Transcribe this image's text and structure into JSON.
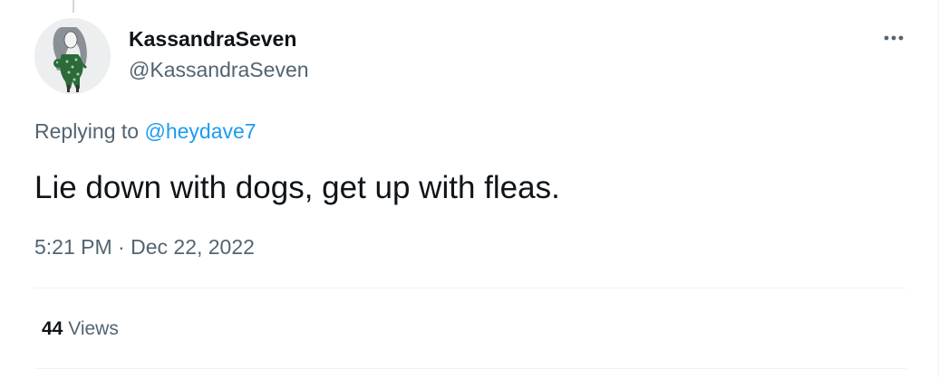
{
  "tweet": {
    "display_name": "KassandraSeven",
    "handle": "@KassandraSeven",
    "more_icon": "more-horizontal-icon",
    "replying_prefix": "Replying to ",
    "replying_mention": "@heydave7",
    "text": "Lie down with dogs, get up with fleas.",
    "time": "5:21 PM",
    "separator": " · ",
    "date": "Dec 22, 2022",
    "views_count": "44",
    "views_label": " Views"
  },
  "colors": {
    "text_primary": "#0f1419",
    "text_secondary": "#536471",
    "link": "#1d9bf0",
    "divider": "#eff3f4",
    "avatar_figure": "#2d6a3a"
  }
}
